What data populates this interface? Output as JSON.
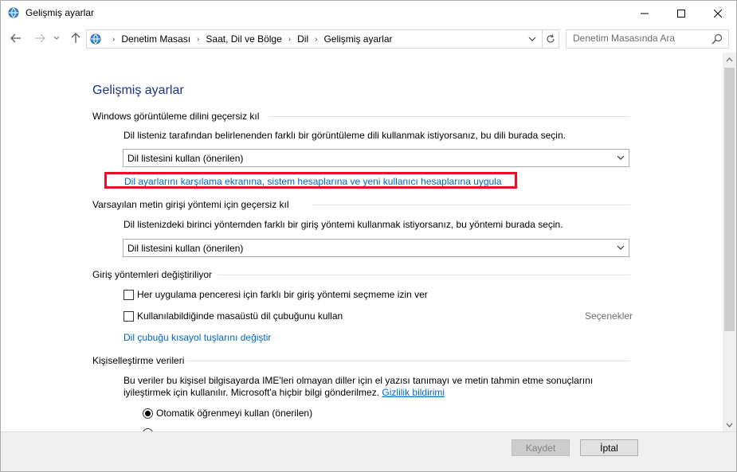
{
  "window": {
    "title": "Gelişmiş ayarlar"
  },
  "nav": {
    "breadcrumbs": [
      "Denetim Masası",
      "Saat, Dil ve Bölge",
      "Dil",
      "Gelişmiş ayarlar"
    ],
    "search_placeholder": "Denetim Masasında Ara"
  },
  "page": {
    "heading": "Gelişmiş ayarlar",
    "display_language": {
      "title": "Windows görüntüleme dilini geçersiz kıl",
      "description": "Dil listeniz tarafından belirlenenden farklı bir görüntüleme dili kullanmak istiyorsanız, bu dili burada seçin.",
      "selected": "Dil listesini kullan (önerilen)",
      "apply_link": "Dil ayarlarını karşılama ekranına, sistem hesaplarına ve yeni kullanıcı hesaplarına uygula"
    },
    "input_method": {
      "title": "Varsayılan metin girişi yöntemi için geçersiz kıl",
      "description": "Dil listenizdeki birinci yöntemden farklı bir giriş yöntemi kullanmak istiyorsanız, bu yöntemi burada seçin.",
      "selected": "Dil listesini kullan (önerilen)"
    },
    "switching": {
      "title": "Giriş yöntemleri değiştiriliyor",
      "checkbox1": "Her uygulama penceresi için farklı bir giriş yöntemi seçmeme izin ver",
      "checkbox2": "Kullanılabildiğinde masaüstü dil çubuğunu kullan",
      "options_label": "Seçenekler",
      "hotkeys_link": "Dil çubuğu kısayol tuşlarını değiştir"
    },
    "personalization": {
      "title": "Kişiselleştirme verileri",
      "description_line1": "Bu veriler bu kişisel bilgisayarda IME'leri olmayan diller için el yazısı tanımayı ve metin tahmin etme sonuçlarını",
      "description_line2": "iyileştirmek için kullanılır. Microsoft'a hiçbir bilgi gönderilmez.",
      "privacy_link": "Gizlilik bildirimi",
      "radio1": "Otomatik öğrenmeyi kullan (önerilen)"
    }
  },
  "footer": {
    "save_label": "Kaydet",
    "cancel_label": "İptal"
  },
  "colors": {
    "heading": "#1e3287",
    "link": "#0066cc",
    "highlight": "#e81123"
  }
}
